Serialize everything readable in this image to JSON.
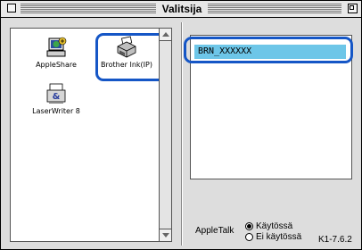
{
  "window": {
    "title": "Valitsija"
  },
  "chooser": {
    "items": [
      {
        "label": "AppleShare",
        "icon": "appleshare-icon"
      },
      {
        "label": "Brother Ink(IP)",
        "icon": "brother-printer-icon"
      },
      {
        "label": "LaserWriter 8",
        "icon": "laserwriter-icon"
      }
    ],
    "selected": "Brother Ink(IP)"
  },
  "printers": {
    "items": [
      {
        "label": "BRN_XXXXXX",
        "selected": true
      }
    ]
  },
  "appletalk": {
    "label": "AppleTalk",
    "options": [
      {
        "label": "Käytössä",
        "checked": true
      },
      {
        "label": "Ei käytössä",
        "checked": false
      }
    ]
  },
  "footer": {
    "version": "K1-7.6.2"
  },
  "colors": {
    "highlight_ring": "#1556c6",
    "selection": "#6dc6e8",
    "window_bg": "#dddddd"
  }
}
